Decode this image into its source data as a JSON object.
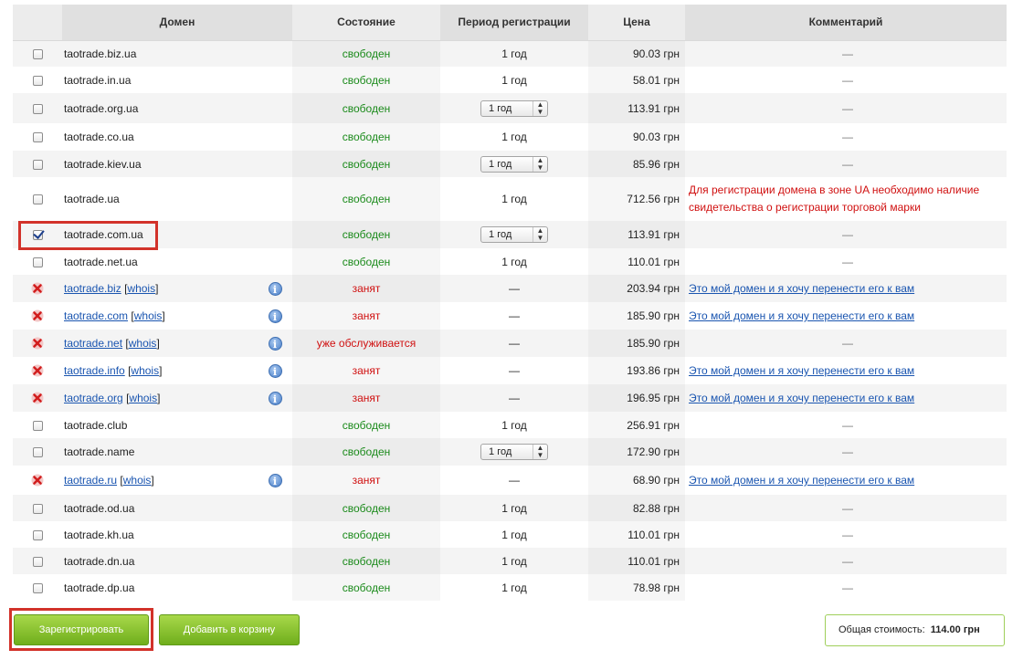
{
  "headers": {
    "domain": "Домен",
    "status": "Состояние",
    "period": "Период регистрации",
    "price": "Цена",
    "comment": "Комментарий"
  },
  "colors": {
    "free": "#1a8a1a",
    "taken": "#d01010",
    "link": "#1a55b0",
    "button_green": "#6fae1c",
    "highlight_box": "#d2322a"
  },
  "rows": [
    {
      "kind": "free",
      "domain": "taotrade.biz.ua",
      "status": "свободен",
      "period": "1 год",
      "period_select": false,
      "price": "90.03 грн",
      "comment": "—",
      "comment_type": "dash",
      "checked": false
    },
    {
      "kind": "free",
      "domain": "taotrade.in.ua",
      "status": "свободен",
      "period": "1 год",
      "period_select": false,
      "price": "58.01 грн",
      "comment": "—",
      "comment_type": "dash",
      "checked": false
    },
    {
      "kind": "free",
      "domain": "taotrade.org.ua",
      "status": "свободен",
      "period": "1 год",
      "period_select": true,
      "price": "113.91 грн",
      "comment": "—",
      "comment_type": "dash",
      "checked": false
    },
    {
      "kind": "free",
      "domain": "taotrade.co.ua",
      "status": "свободен",
      "period": "1 год",
      "period_select": false,
      "price": "90.03 грн",
      "comment": "—",
      "comment_type": "dash",
      "checked": false
    },
    {
      "kind": "free",
      "domain": "taotrade.kiev.ua",
      "status": "свободен",
      "period": "1 год",
      "period_select": true,
      "price": "85.96 грн",
      "comment": "—",
      "comment_type": "dash",
      "checked": false
    },
    {
      "kind": "free",
      "domain": "taotrade.ua",
      "status": "свободен",
      "period": "1 год",
      "period_select": false,
      "price": "712.56 грн",
      "comment": "Для регистрации домена в зоне UA необходимо наличие свидетельства о регистрации торговой марки",
      "comment_type": "warning",
      "checked": false
    },
    {
      "kind": "free",
      "domain": "taotrade.com.ua",
      "status": "свободен",
      "period": "1 год",
      "period_select": true,
      "price": "113.91 грн",
      "comment": "—",
      "comment_type": "dash",
      "checked": true
    },
    {
      "kind": "free",
      "domain": "taotrade.net.ua",
      "status": "свободен",
      "period": "1 год",
      "period_select": false,
      "price": "110.01 грн",
      "comment": "—",
      "comment_type": "dash",
      "checked": false
    },
    {
      "kind": "taken",
      "domain": "taotrade.biz",
      "whois": "whois",
      "status": "занят",
      "period": "—",
      "period_select": false,
      "price": "203.94 грн",
      "comment": "Это мой домен и я хочу перенести его к вам",
      "comment_type": "link"
    },
    {
      "kind": "taken",
      "domain": "taotrade.com",
      "whois": "whois",
      "status": "занят",
      "period": "—",
      "period_select": false,
      "price": "185.90 грн",
      "comment": "Это мой домен и я хочу перенести его к вам",
      "comment_type": "link"
    },
    {
      "kind": "taken",
      "domain": "taotrade.net",
      "whois": "whois",
      "status": "уже обслуживается",
      "period": "—",
      "period_select": false,
      "price": "185.90 грн",
      "comment": "—",
      "comment_type": "dash"
    },
    {
      "kind": "taken",
      "domain": "taotrade.info",
      "whois": "whois",
      "status": "занят",
      "period": "—",
      "period_select": false,
      "price": "193.86 грн",
      "comment": "Это мой домен и я хочу перенести его к вам",
      "comment_type": "link"
    },
    {
      "kind": "taken",
      "domain": "taotrade.org",
      "whois": "whois",
      "status": "занят",
      "period": "—",
      "period_select": false,
      "price": "196.95 грн",
      "comment": "Это мой домен и я хочу перенести его к вам",
      "comment_type": "link"
    },
    {
      "kind": "free",
      "domain": "taotrade.club",
      "status": "свободен",
      "period": "1 год",
      "period_select": false,
      "price": "256.91 грн",
      "comment": "—",
      "comment_type": "dash",
      "checked": false
    },
    {
      "kind": "free",
      "domain": "taotrade.name",
      "status": "свободен",
      "period": "1 год",
      "period_select": true,
      "price": "172.90 грн",
      "comment": "—",
      "comment_type": "dash",
      "checked": false
    },
    {
      "kind": "taken",
      "domain": "taotrade.ru",
      "whois": "whois",
      "status": "занят",
      "period": "—",
      "period_select": false,
      "price": "68.90 грн",
      "comment": "Это мой домен и я хочу перенести его к вам",
      "comment_type": "link"
    },
    {
      "kind": "free",
      "domain": "taotrade.od.ua",
      "status": "свободен",
      "period": "1 год",
      "period_select": false,
      "price": "82.88 грн",
      "comment": "—",
      "comment_type": "dash",
      "checked": false
    },
    {
      "kind": "free",
      "domain": "taotrade.kh.ua",
      "status": "свободен",
      "period": "1 год",
      "period_select": false,
      "price": "110.01 грн",
      "comment": "—",
      "comment_type": "dash",
      "checked": false
    },
    {
      "kind": "free",
      "domain": "taotrade.dn.ua",
      "status": "свободен",
      "period": "1 год",
      "period_select": false,
      "price": "110.01 грн",
      "comment": "—",
      "comment_type": "dash",
      "checked": false
    },
    {
      "kind": "free",
      "domain": "taotrade.dp.ua",
      "status": "свободен",
      "period": "1 год",
      "period_select": false,
      "price": "78.98 грн",
      "comment": "—",
      "comment_type": "dash",
      "checked": false
    }
  ],
  "actions": {
    "register_label": "Зарегистрировать",
    "add_to_cart_label": "Добавить в корзину"
  },
  "total": {
    "label": "Общая стоимость:",
    "value": "114.00 грн"
  }
}
